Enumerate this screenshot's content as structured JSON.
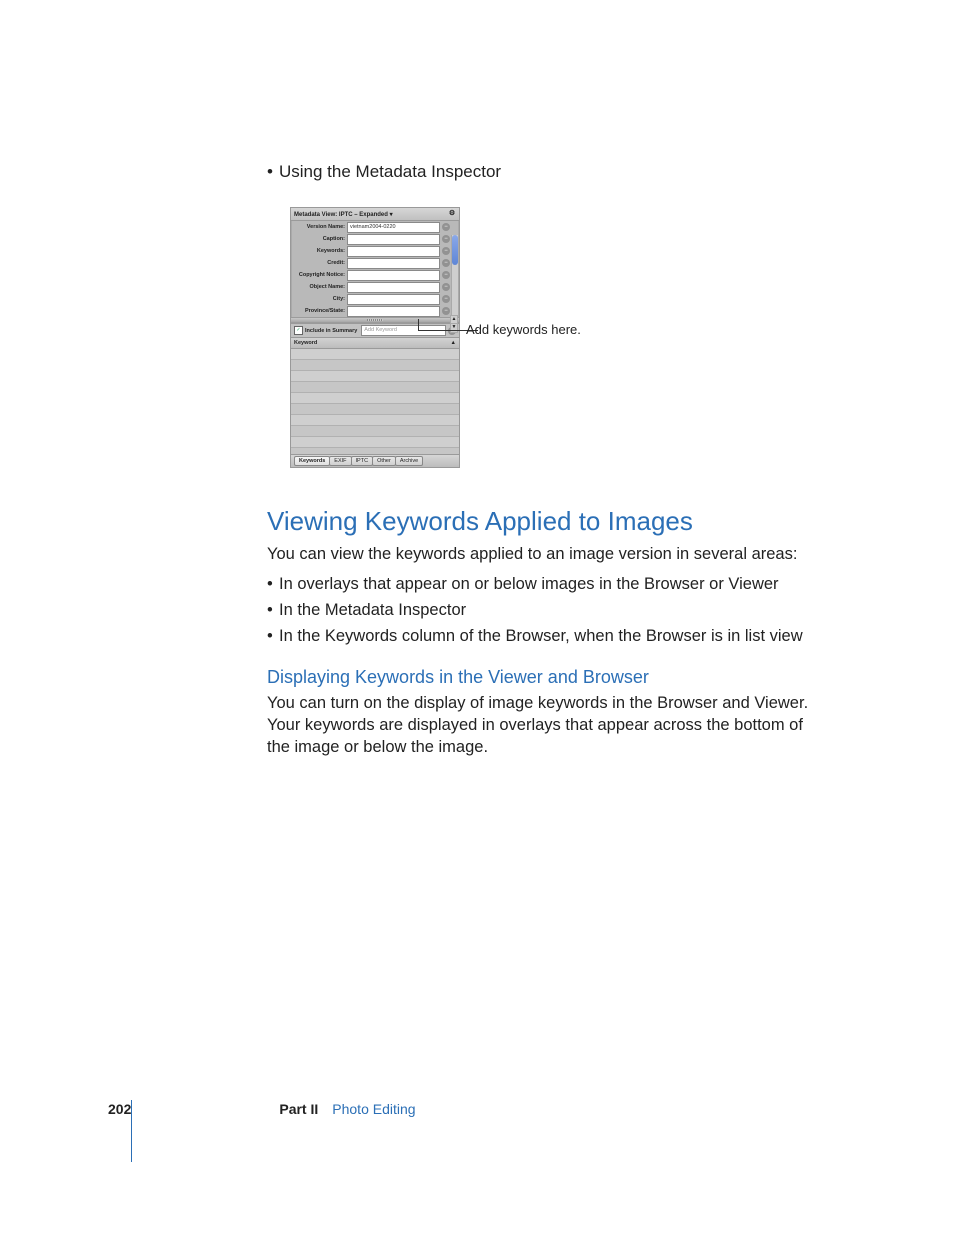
{
  "intro_bullet": "Using the Metadata Inspector",
  "panel": {
    "title": "Metadata View: IPTC – Expanded ▾",
    "gear_label": "⚙",
    "fields": [
      {
        "label": "Version Name:",
        "value": "vietnam2004-0220"
      },
      {
        "label": "Caption:",
        "value": ""
      },
      {
        "label": "Keywords:",
        "value": ""
      },
      {
        "label": "Credit:",
        "value": ""
      },
      {
        "label": "Copyright Notice:",
        "value": ""
      },
      {
        "label": "Object Name:",
        "value": ""
      },
      {
        "label": "City:",
        "value": ""
      },
      {
        "label": "Province/State:",
        "value": ""
      }
    ],
    "include_label": "Include in Summary",
    "add_placeholder": "Add Keyword",
    "keyword_header": "Keyword",
    "tabs": [
      "Keywords",
      "EXIF",
      "IPTC",
      "Other",
      "Archive"
    ]
  },
  "callout": "Add keywords here.",
  "section": {
    "h1": "Viewing Keywords Applied to Images",
    "p1": "You can view the keywords applied to an image version in several areas:",
    "bullets": [
      "In overlays that appear on or below images in the Browser or Viewer",
      "In the Metadata Inspector",
      "In the Keywords column of the Browser, when the Browser is in list view"
    ],
    "h2": "Displaying Keywords in the Viewer and Browser",
    "p2": "You can turn on the display of image keywords in the Browser and Viewer. Your keywords are displayed in overlays that appear across the bottom of the image or below the image."
  },
  "footer": {
    "page": "202",
    "part": "Part II",
    "title": "Photo Editing"
  }
}
